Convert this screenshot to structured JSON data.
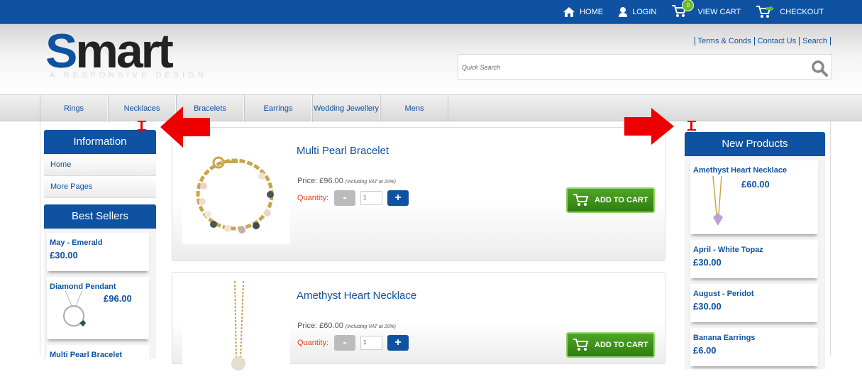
{
  "topbar": {
    "home": "HOME",
    "login": "LOGIN",
    "cart_count": "0",
    "view_cart": "VIEW CART",
    "checkout": "CHECKOUT"
  },
  "logo": {
    "title": "Smart",
    "tagline": "A RESPONSIVE DESIGN"
  },
  "header_links": [
    "Terms & Conds",
    "Contact Us",
    "Search"
  ],
  "search": {
    "placeholder": "Quick Search"
  },
  "nav": [
    "Rings",
    "Necklaces",
    "Bracelets",
    "Earrings",
    "Wedding Jewellery",
    "Mens"
  ],
  "left_sidebar": {
    "info_title": "Information",
    "info_links": [
      "Home",
      "More Pages"
    ],
    "bestsellers_title": "Best Sellers",
    "bestsellers": [
      {
        "name": "May - Emerald",
        "price": "£30.00"
      },
      {
        "name": "Diamond Pendant",
        "price": "£96.00"
      },
      {
        "name": "Multi Pearl Bracelet",
        "price": ""
      }
    ]
  },
  "products": [
    {
      "name": "Multi Pearl Bracelet",
      "price": "Price: £96.00",
      "vat": "(Including VAT at 20%)",
      "qty_label": "Quantity:",
      "qty": "1",
      "button": "ADD TO CART"
    },
    {
      "name": "Amethyst Heart Necklace",
      "price": "Price: £60.00",
      "vat": "(Including VAT at 20%)",
      "qty_label": "Quantity:",
      "qty": "1",
      "button": "ADD TO CART"
    }
  ],
  "right_sidebar": {
    "title": "New Products",
    "items": [
      {
        "name": "Amethyst Heart Necklace",
        "price": "£60.00"
      },
      {
        "name": "April - White Topaz",
        "price": "£30.00"
      },
      {
        "name": "August - Peridot",
        "price": "£30.00"
      },
      {
        "name": "Banana Earrings",
        "price": "£6.00"
      }
    ]
  },
  "colors": {
    "brand": "#0e52a1",
    "green": "#3a8f1a",
    "annotation_red": "#e00000"
  }
}
